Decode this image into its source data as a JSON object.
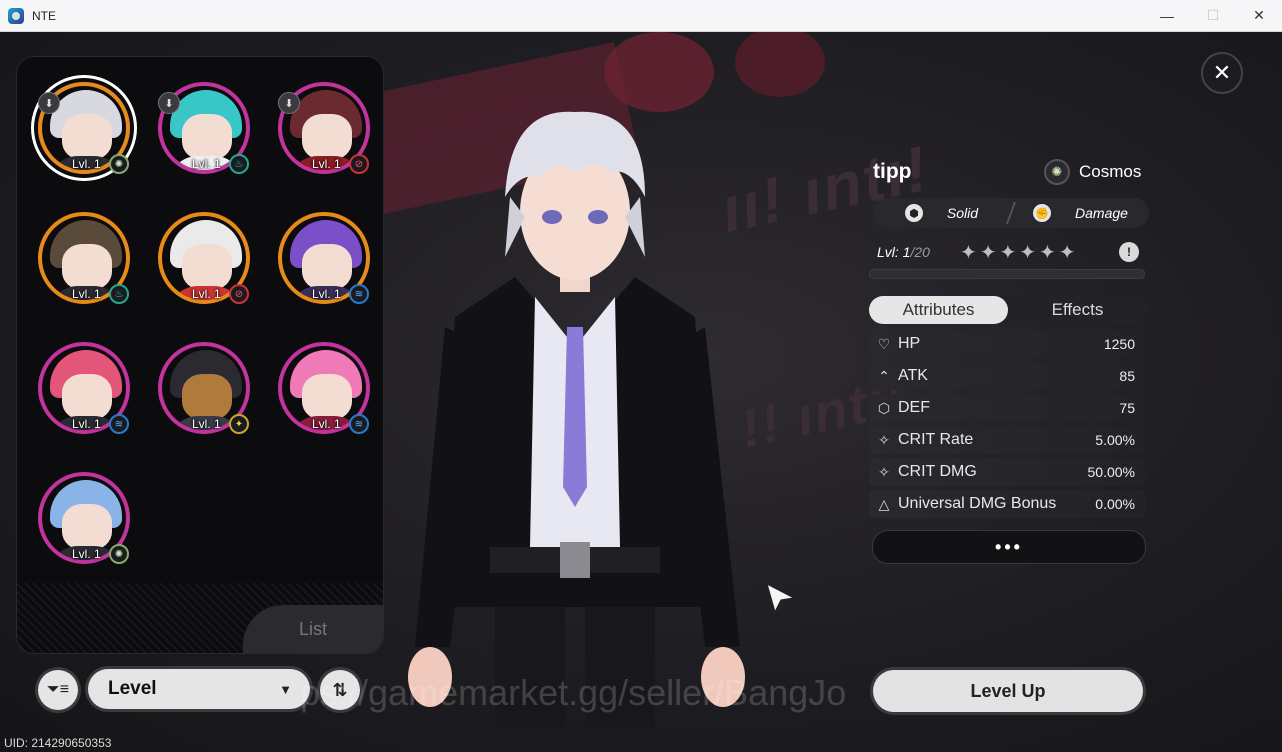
{
  "window": {
    "title": "NTE",
    "minimize": "—",
    "maximize": "☐",
    "close": "✕"
  },
  "characters": [
    {
      "level": "Lvl. 1",
      "element": "cosmos",
      "selected": true
    },
    {
      "level": "Lvl. 1",
      "element": "nature"
    },
    {
      "level": "Lvl. 1",
      "element": "incantation"
    },
    {
      "level": "Lvl. 1",
      "element": "nature"
    },
    {
      "level": "Lvl. 1",
      "element": "incantation"
    },
    {
      "level": "Lvl. 1",
      "element": "aqua"
    },
    {
      "level": "Lvl. 1",
      "element": "aqua"
    },
    {
      "level": "Lvl. 1",
      "element": "lightning"
    },
    {
      "level": "Lvl. 1",
      "element": "aqua"
    },
    {
      "level": "Lvl. 1",
      "element": "cosmos"
    }
  ],
  "list_tab": "List",
  "sort": {
    "filter_icon": "filter-icon",
    "label": "Level",
    "order_icon": "sort-order-icon"
  },
  "uid": "UID: 214290650353",
  "watermark": "ps://gamemarket.gg/seller/BangJo",
  "info": {
    "name": "tipp",
    "path": "Cosmos",
    "tags": [
      "Solid",
      "Damage"
    ],
    "level": "Lvl: 1",
    "level_max": "/20",
    "stars": "✦✦✦✦✦✦",
    "tabs": [
      "Attributes",
      "Effects"
    ],
    "stats": [
      {
        "icon": "♡",
        "name": "HP",
        "value": "1250"
      },
      {
        "icon": "⌃",
        "name": "ATK",
        "value": "85"
      },
      {
        "icon": "⬡",
        "name": "DEF",
        "value": "75"
      },
      {
        "icon": "✧",
        "name": "CRIT Rate",
        "value": "5.00%"
      },
      {
        "icon": "✧",
        "name": "CRIT DMG",
        "value": "50.00%"
      },
      {
        "icon": "△",
        "name": "Universal DMG Bonus",
        "value": "0.00%"
      }
    ],
    "more": "•••",
    "level_up": "Level Up"
  },
  "colors": {
    "accent_pink": "#c2339d",
    "accent_orange": "#e88a1a",
    "background": "#1d1c20"
  }
}
